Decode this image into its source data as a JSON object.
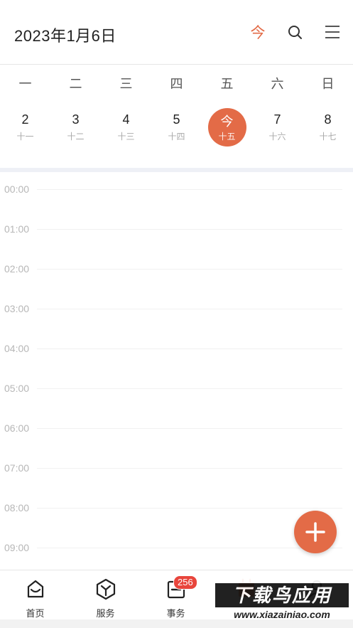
{
  "header": {
    "date_title": "2023年1月6日",
    "today_label": "今"
  },
  "weekdays": [
    "一",
    "二",
    "三",
    "四",
    "五",
    "六",
    "日"
  ],
  "dates": [
    {
      "day": "2",
      "lunar": "十一"
    },
    {
      "day": "3",
      "lunar": "十二"
    },
    {
      "day": "4",
      "lunar": "十三"
    },
    {
      "day": "5",
      "lunar": "十四"
    },
    {
      "day": "今",
      "lunar": "十五"
    },
    {
      "day": "7",
      "lunar": "十六"
    },
    {
      "day": "8",
      "lunar": "十七"
    }
  ],
  "timeline": {
    "slots": [
      "00:00",
      "01:00",
      "02:00",
      "03:00",
      "04:00",
      "05:00",
      "06:00",
      "07:00",
      "08:00",
      "09:00"
    ]
  },
  "tabbar": {
    "tabs": [
      {
        "label": "首页",
        "icon": "home-icon"
      },
      {
        "label": "服务",
        "icon": "box-icon"
      },
      {
        "label": "事务",
        "icon": "task-icon"
      },
      {
        "label": "",
        "icon": "calendar-icon"
      },
      {
        "label": "",
        "icon": "person-icon"
      }
    ],
    "badge": "256"
  },
  "watermark": {
    "main": "下载鸟应用",
    "sub": "www.xiazainiao.com"
  },
  "colors": {
    "accent": "#e36b47",
    "badge": "#e8453c"
  }
}
